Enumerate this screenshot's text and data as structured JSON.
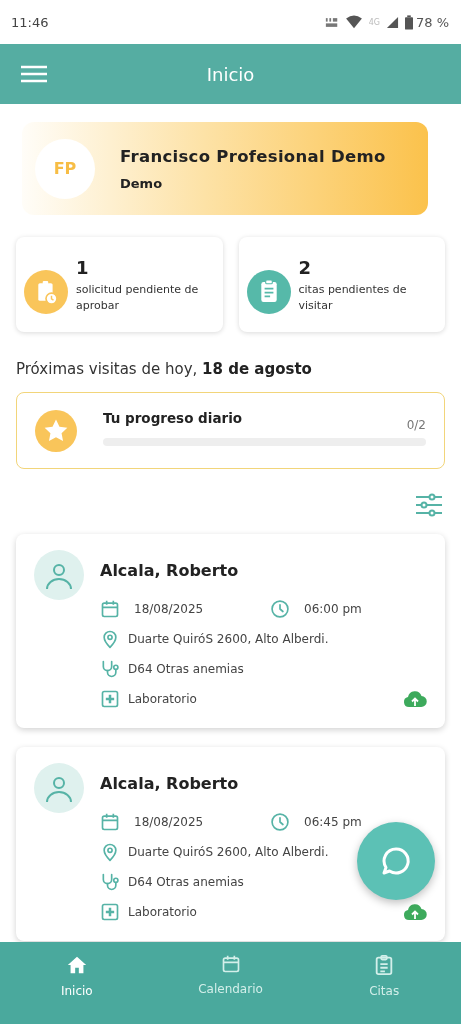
{
  "status_bar": {
    "time": "11:46",
    "network": "4G",
    "battery": "78 %"
  },
  "app_bar": {
    "title": "Inicio"
  },
  "profile": {
    "initials": "FP",
    "name": "Francisco Profesional Demo",
    "role": "Demo"
  },
  "stats": [
    {
      "kind": "request",
      "count": "1",
      "label": "solicitud pendiente de aprobar"
    },
    {
      "kind": "appointment",
      "count": "2",
      "label": "citas pendientes de visitar"
    }
  ],
  "visits_heading": "Próximas visitas de hoy, **18 de agosto**",
  "progress": {
    "title": "Tu progreso diario",
    "reading": "0/2",
    "level": 0
  },
  "visits": [
    {
      "name": "Alcala, Roberto",
      "date": "18/08/2025",
      "time": "06:00 pm",
      "address": "Duarte QuiróS  2600, Alto Alberdi.",
      "diagnosis": "D64 Otras anemias",
      "service": "Laboratorio"
    },
    {
      "name": "Alcala, Roberto",
      "date": "18/08/2025",
      "time": "06:45 pm",
      "address": "Duarte QuiróS  2600, Alto Alberdi.",
      "diagnosis": "D64 Otras anemias",
      "service": "Laboratorio"
    }
  ],
  "bottom_nav": [
    {
      "kind": "home",
      "label": "Inicio",
      "selected": true
    },
    {
      "kind": "calendar",
      "label": "Calendario",
      "selected": false
    },
    {
      "kind": "clipboard",
      "label": "Citas",
      "selected": false
    }
  ]
}
